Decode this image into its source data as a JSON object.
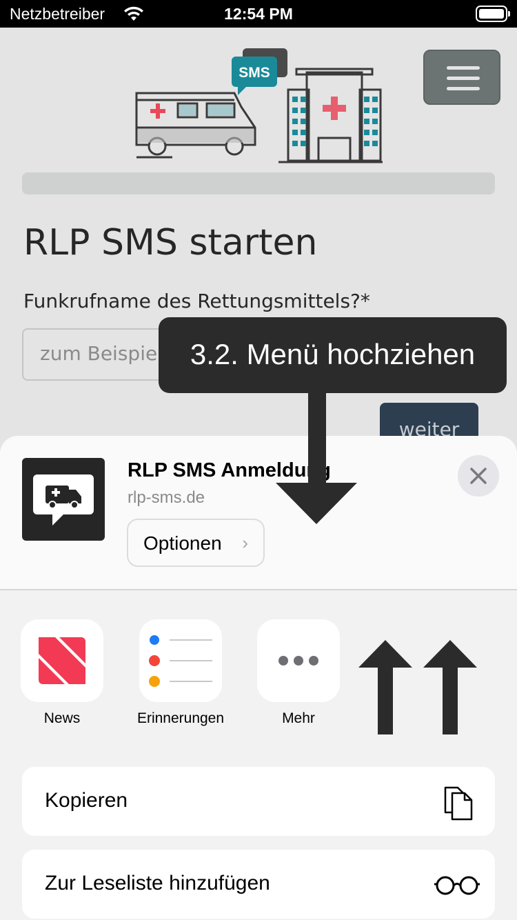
{
  "status_bar": {
    "carrier": "Netzbetreiber",
    "time": "12:54 PM"
  },
  "webpage": {
    "illustration_badge": "SMS",
    "title": "RLP SMS starten",
    "field_label": "Funkrufname des Rettungsmittels?*",
    "field_placeholder": "zum Beispiel",
    "next_button": "weiter"
  },
  "tutorial": {
    "callout": "3.2. Menü hochziehen"
  },
  "share_sheet": {
    "site_title": "RLP SMS Anmeldung",
    "site_url": "rlp-sms.de",
    "options_label": "Optionen",
    "apps": [
      {
        "name": "News",
        "icon": "news-icon"
      },
      {
        "name": "Erinnerungen",
        "icon": "reminders-icon"
      },
      {
        "name": "Mehr",
        "icon": "more-icon"
      }
    ],
    "actions": [
      {
        "label": "Kopieren",
        "icon": "copy-icon"
      },
      {
        "label": "Zur Leseliste hinzufügen",
        "icon": "glasses-icon"
      }
    ]
  },
  "colors": {
    "news_red": "#f23a55",
    "reminder_blue": "#1c7bf5",
    "reminder_red": "#f2463a",
    "reminder_orange": "#f5a20c",
    "teal_accent": "#1a8a99",
    "cross_red": "#e8485a"
  }
}
